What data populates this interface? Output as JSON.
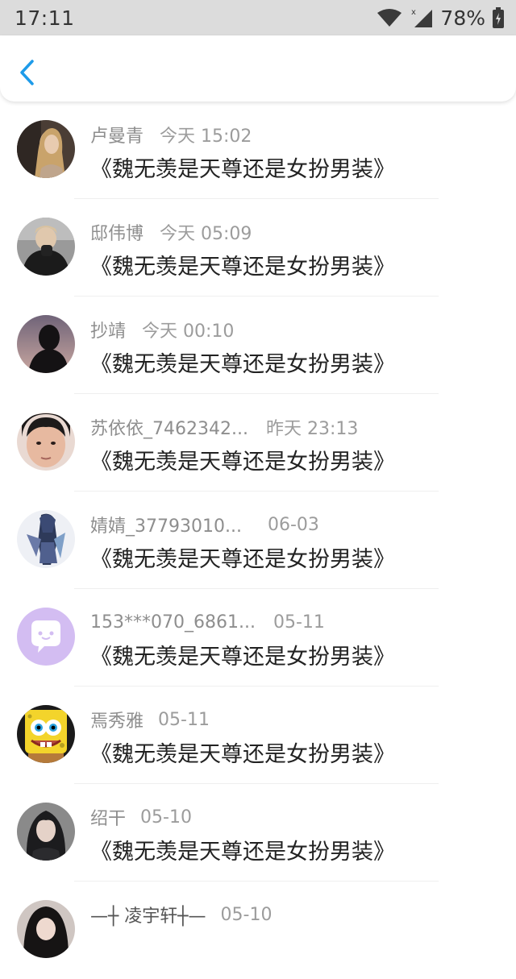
{
  "status_bar": {
    "time": "17:11",
    "battery": "78%",
    "icons": [
      "wifi-icon",
      "signal-icon",
      "battery-icon"
    ]
  },
  "header": {
    "back_icon": "chevron-left-icon",
    "accent_color": "#1e9be9"
  },
  "messages": [
    {
      "name": "卢曼青",
      "time": "今天 15:02",
      "text": "《魏无羡是天尊还是女扮男装》",
      "avatar": "girl-blonde-photo"
    },
    {
      "name": "邸伟博",
      "time": "今天 05:09",
      "text": "《魏无羡是天尊还是女扮男装》",
      "avatar": "boy-black-hoodie-photo"
    },
    {
      "name": "抄靖",
      "time": "今天 00:10",
      "text": "《魏无羡是天尊还是女扮男装》",
      "avatar": "silhouette-photo"
    },
    {
      "name": "苏依依_7462342...",
      "time": "昨天 23:13",
      "text": "《魏无羡是天尊还是女扮男装》",
      "avatar": "girl-face-photo"
    },
    {
      "name": "婧婧_37793010...",
      "time": "06-03",
      "text": "《魏无羡是天尊还是女扮男装》",
      "avatar": "anime-character"
    },
    {
      "name": "153***070_6861...",
      "time": "05-11",
      "text": "《魏无羡是天尊还是女扮男装》",
      "avatar": "default-chat-bubble-icon"
    },
    {
      "name": "焉秀雅",
      "time": "05-11",
      "text": "《魏无羡是天尊还是女扮男装》",
      "avatar": "spongebob-cartoon"
    },
    {
      "name": "绍干",
      "time": "05-10",
      "text": "《魏无羡是天尊还是女扮男装》",
      "avatar": "dark-hair-girl-photo"
    },
    {
      "name": "凌宇轩",
      "time": "05-10",
      "text": "",
      "avatar": "dark-hair-photo"
    }
  ]
}
